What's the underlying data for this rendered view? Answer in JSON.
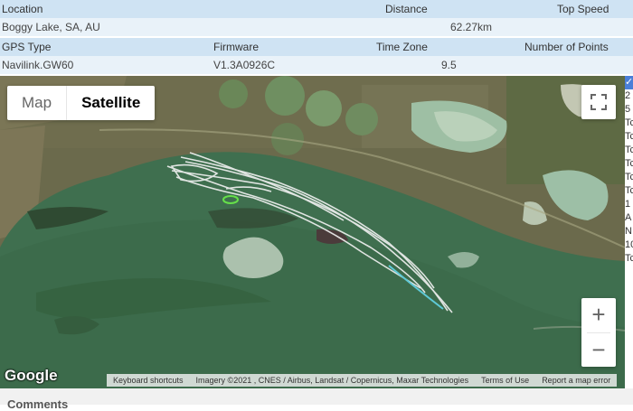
{
  "info": {
    "headers1": {
      "location": "Location",
      "distance": "Distance",
      "top_speed": "Top Speed"
    },
    "values1": {
      "location": "Boggy Lake, SA, AU",
      "distance": "62.27km",
      "top_speed": ""
    },
    "headers2": {
      "gps_type": "GPS Type",
      "firmware": "Firmware",
      "time_zone": "Time Zone",
      "points": "Number of Points"
    },
    "values2": {
      "gps_type": "Navilink.GW60",
      "firmware": "V1.3A0926C",
      "time_zone": "9.5",
      "points": ""
    }
  },
  "map": {
    "type_map": "Map",
    "type_satellite": "Satellite",
    "zoom_in": "+",
    "zoom_out": "−",
    "logo": "Google",
    "attribution": {
      "shortcuts": "Keyboard shortcuts",
      "imagery": "Imagery ©2021 , CNES / Airbus, Landsat / Copernicus, Maxar Technologies",
      "terms": "Terms of Use",
      "report": "Report a map error"
    },
    "colors": {
      "lake": "#3f6f4f",
      "land": "#6b6a4c",
      "track": "#f2f2f2",
      "track_end": "#5ec9d6"
    }
  },
  "side_list": [
    "2",
    "5",
    "Tc",
    "Tc",
    "Tc",
    "Tc",
    "Tc",
    "Tc",
    "1",
    "A",
    "N",
    "10",
    "Tc"
  ],
  "comments": {
    "label": "Comments"
  }
}
